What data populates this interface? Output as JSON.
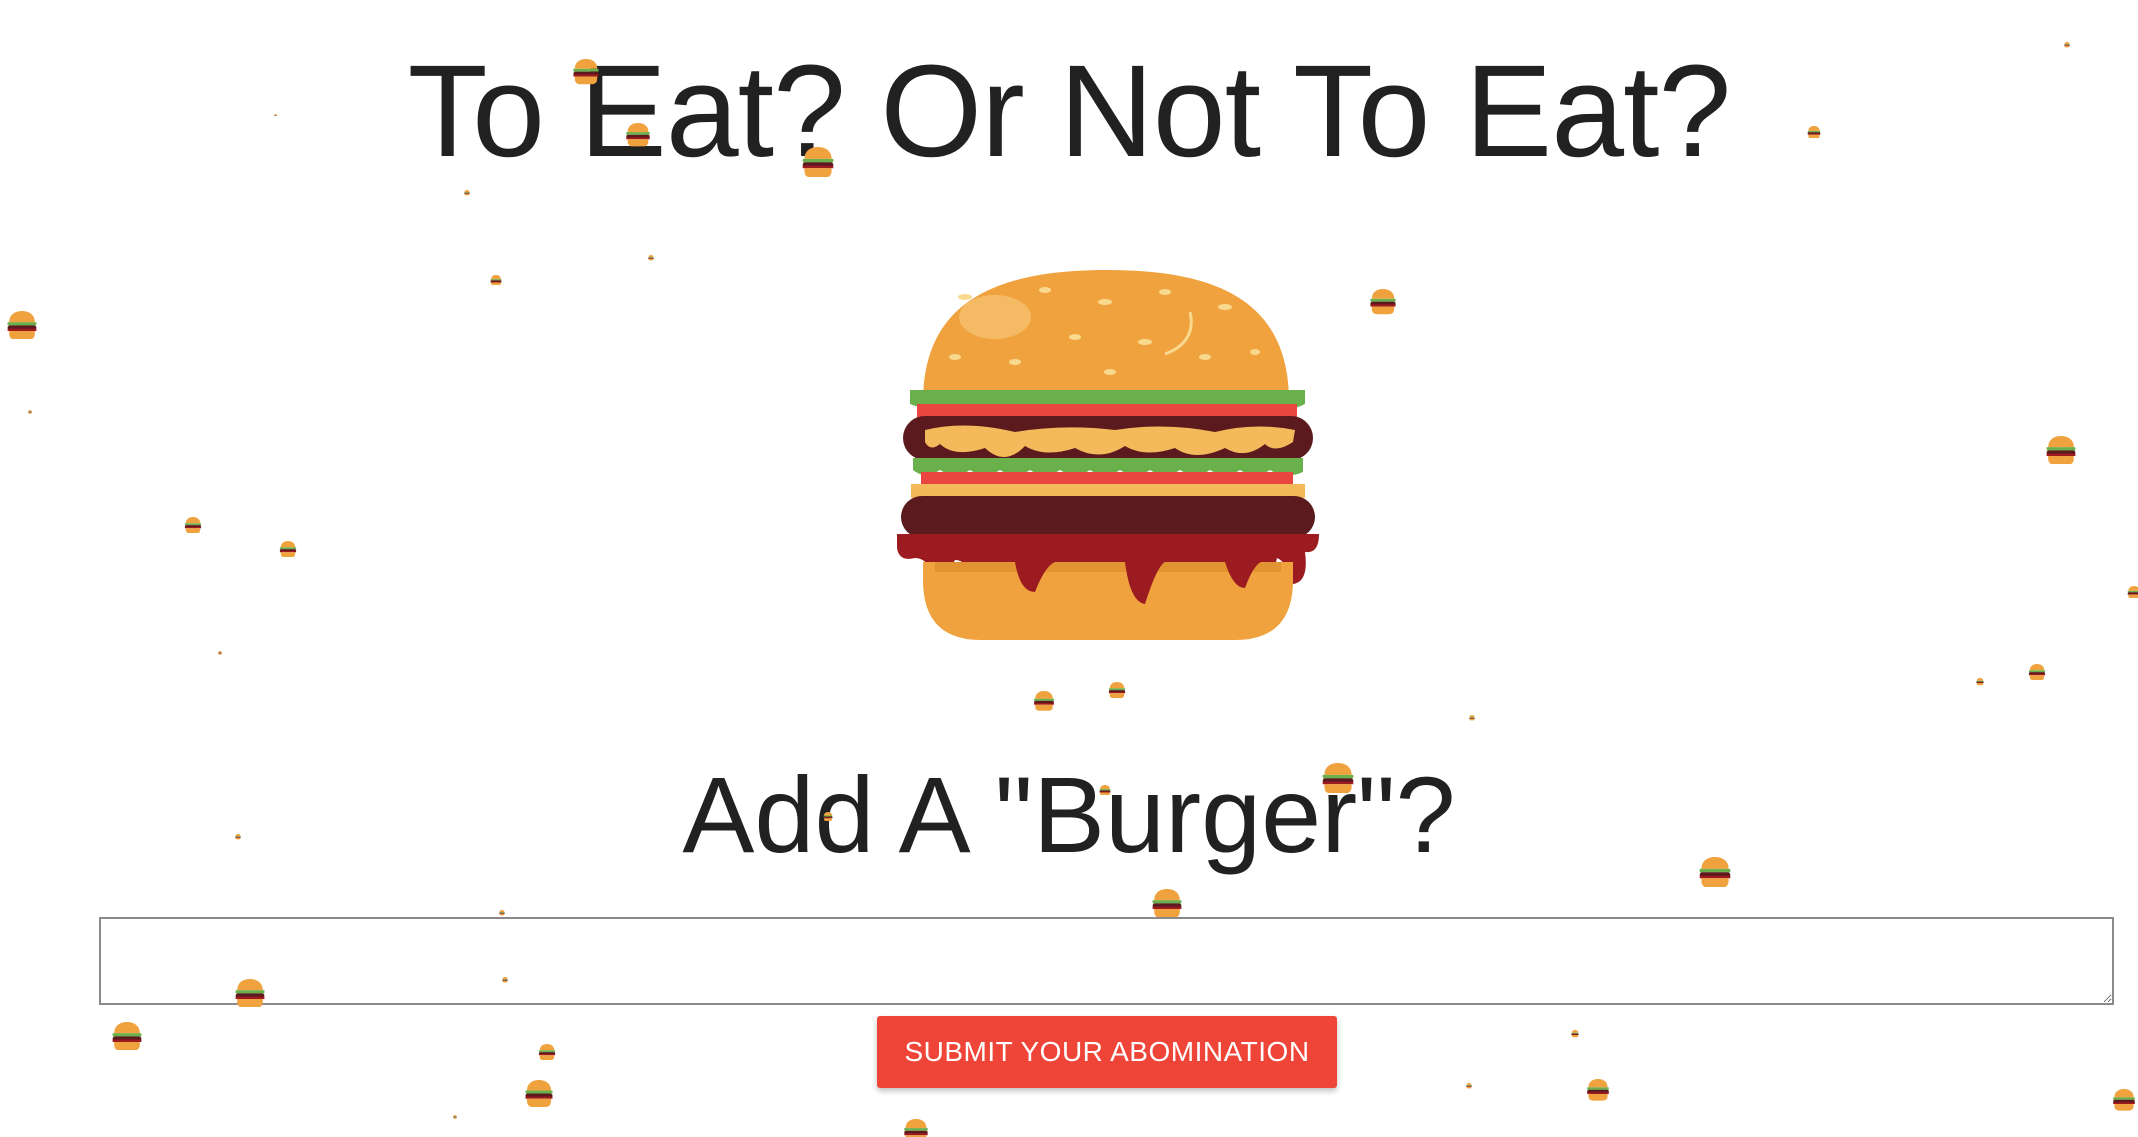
{
  "page": {
    "title": "To Eat? Or Not To Eat?"
  },
  "hero": {
    "icon": "burger-icon"
  },
  "add_section": {
    "heading": "Add A \"Burger\"?",
    "textarea_value": "",
    "textarea_placeholder": ""
  },
  "actions": {
    "submit_label": "SUBMIT YOUR ABOMINATION"
  },
  "decor": {
    "falling_icon": "burger-icon"
  },
  "colors": {
    "accent": "#ef4538",
    "text": "#212121",
    "bun": "#f0a23e",
    "patty": "#5b1a1d",
    "lettuce": "#6ab04c",
    "tomato": "#e8463f",
    "cheese": "#f3b95a",
    "sauce": "#9b1b20"
  }
}
